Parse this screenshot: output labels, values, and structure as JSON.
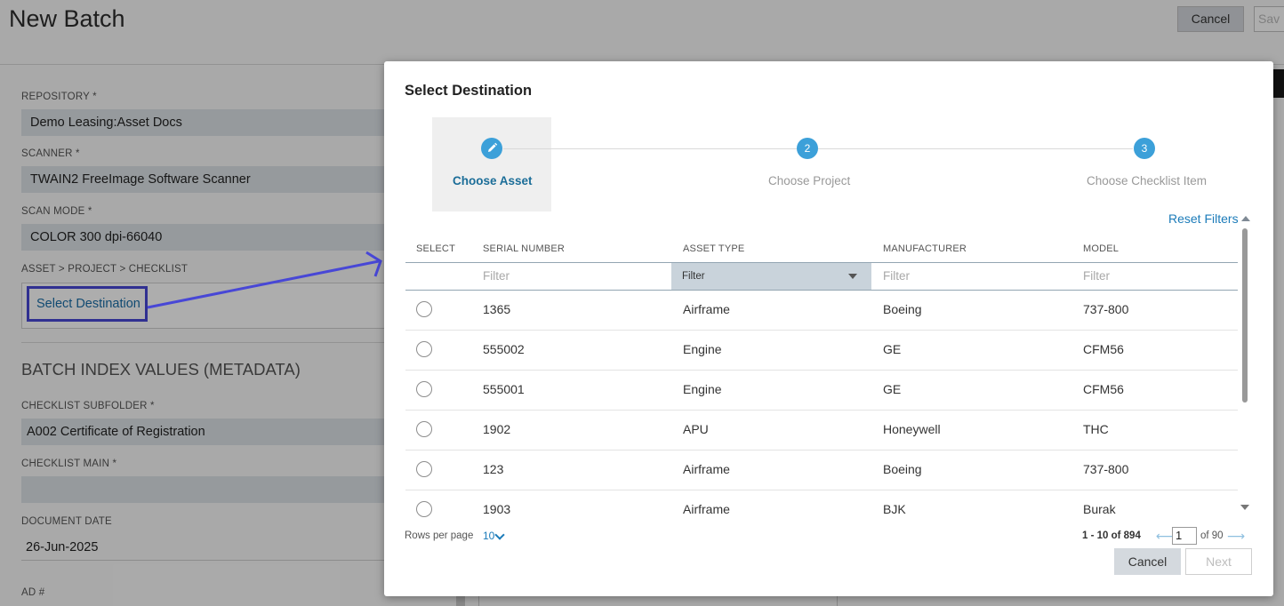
{
  "page": {
    "title": "New Batch",
    "cancel_label": "Cancel",
    "save_label": "Sav",
    "fields": [
      {
        "label": "REPOSITORY *",
        "value": "Demo Leasing:Asset Docs"
      },
      {
        "label": "SCANNER *",
        "value": "TWAIN2 FreeImage Software Scanner"
      },
      {
        "label": "SCAN MODE *",
        "value": "COLOR 300 dpi-66040"
      },
      {
        "label": "ASSET > PROJECT > CHECKLIST",
        "value": "Select Destination"
      },
      {
        "label": "CHECKLIST SUBFOLDER *",
        "value": "A002 Certificate of Registration"
      },
      {
        "label": "CHECKLIST MAIN *",
        "value": ""
      },
      {
        "label": "DOCUMENT DATE",
        "value": "26-Jun-2025"
      },
      {
        "label": "AD #",
        "value": ""
      }
    ],
    "section_title": "BATCH INDEX VALUES (METADATA)"
  },
  "modal": {
    "title": "Select Destination",
    "steps": [
      {
        "number": "1",
        "label": "Choose Asset",
        "icon": "pencil-icon",
        "active": true
      },
      {
        "number": "2",
        "label": "Choose Project",
        "active": false
      },
      {
        "number": "3",
        "label": "Choose Checklist Item",
        "active": false
      }
    ],
    "reset_filters": "Reset Filters",
    "columns": [
      "SELECT",
      "SERIAL NUMBER",
      "ASSET TYPE",
      "MANUFACTURER",
      "MODEL"
    ],
    "filter_placeholder": "Filter",
    "filter_select": "Filter",
    "rows": [
      {
        "serial": "1365",
        "type": "Airframe",
        "manufacturer": "Boeing",
        "model": "737-800"
      },
      {
        "serial": "555002",
        "type": "Engine",
        "manufacturer": "GE",
        "model": "CFM56"
      },
      {
        "serial": "555001",
        "type": "Engine",
        "manufacturer": "GE",
        "model": "CFM56"
      },
      {
        "serial": "1902",
        "type": "APU",
        "manufacturer": "Honeywell",
        "model": "THC"
      },
      {
        "serial": "123",
        "type": "Airframe",
        "manufacturer": "Boeing",
        "model": "737-800"
      },
      {
        "serial": "1903",
        "type": "Airframe",
        "manufacturer": "BJK",
        "model": "Burak"
      }
    ],
    "pager": {
      "rows_per_page_label": "Rows per page",
      "rows_per_page": "10",
      "range": "1 - 10 of 894",
      "prev_arrow": "⟵",
      "next_arrow": "⟶",
      "page": "1",
      "of_pages": "of 90"
    },
    "cancel_label": "Cancel",
    "next_label": "Next"
  },
  "colors": {
    "accent": "#3ca0d9",
    "link": "#1b7bb9",
    "annotation": "#4847d6"
  }
}
